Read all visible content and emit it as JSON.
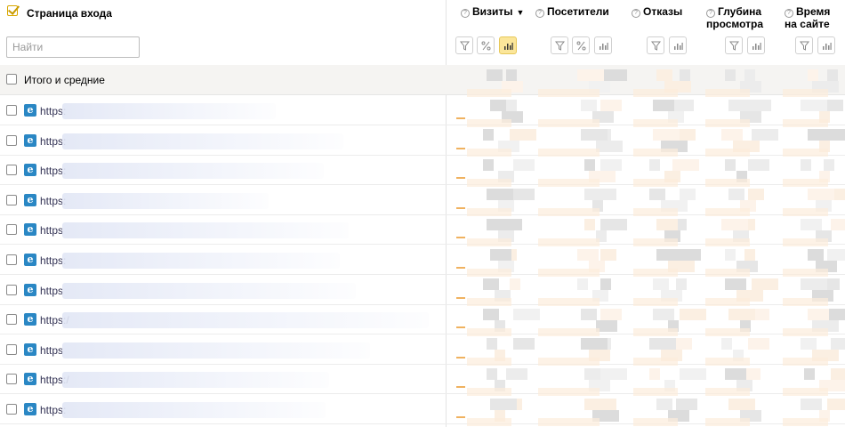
{
  "header": {
    "title": "Страница входа",
    "search_placeholder": "Найти"
  },
  "columns": [
    {
      "label": "Визиты",
      "sorted": "▼"
    },
    {
      "label": "Посетители",
      "sorted": ""
    },
    {
      "label": "Отказы",
      "sorted": ""
    },
    {
      "label": "Глубина просмотра",
      "sorted": ""
    },
    {
      "label": "Время на сайте",
      "sorted": ""
    }
  ],
  "totals_label": "Итого и средние",
  "rows": [
    {
      "url": "https:"
    },
    {
      "url": "https:"
    },
    {
      "url": "https:"
    },
    {
      "url": "https:"
    },
    {
      "url": "https"
    },
    {
      "url": "https:"
    },
    {
      "url": "https"
    },
    {
      "url": "https:/"
    },
    {
      "url": "https"
    },
    {
      "url": "https:/"
    },
    {
      "url": "https:"
    }
  ],
  "colors": {
    "accent_yellow": "#fbe69a",
    "link": "#2a87c4",
    "bar": "#f0b260"
  }
}
